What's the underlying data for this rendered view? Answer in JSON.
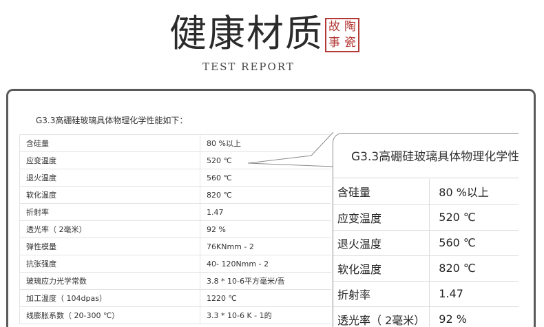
{
  "header": {
    "title": "健康材质",
    "seal": [
      "故",
      "陶",
      "事",
      "瓷"
    ],
    "subtitle": "TEST REPORT"
  },
  "spec": {
    "intro": "G3.3高硼硅玻璃具体物理化学性能如下：",
    "rows": [
      {
        "k": "含硅量",
        "v": "80 %以上"
      },
      {
        "k": "应变温度",
        "v": "520 ℃"
      },
      {
        "k": "退火温度",
        "v": "560 ℃"
      },
      {
        "k": "软化温度",
        "v": "820 ℃"
      },
      {
        "k": "折射率",
        "v": "1.47"
      },
      {
        "k": "透光率（ 2毫米）",
        "v": "92 %"
      },
      {
        "k": "弹性模量",
        "v": "76KNmm - 2"
      },
      {
        "k": "抗张强度",
        "v": "40- 120Nmm - 2"
      },
      {
        "k": "玻璃应力光学常数",
        "v": "3.8 * 10-6平方毫米/吾"
      },
      {
        "k": "加工温度（ 104dpas）",
        "v": "1220 ℃"
      },
      {
        "k": "线膨胀系数（ 20-300 ℃）",
        "v": "3.3 * 10-6 K - 1的"
      }
    ]
  },
  "zoom": {
    "title": "G3.3高硼硅玻璃具体物理化学性",
    "rows": [
      {
        "k": "含硅量",
        "v": "80 %以上"
      },
      {
        "k": "应变温度",
        "v": "520 ℃"
      },
      {
        "k": "退火温度",
        "v": "560 ℃"
      },
      {
        "k": "软化温度",
        "v": "820 ℃"
      },
      {
        "k": "折射率",
        "v": "1.47"
      },
      {
        "k": "透光率（ 2毫米）",
        "v": "92 %"
      }
    ]
  },
  "colors": {
    "seal": "#b23a36",
    "frame": "#5a5a5a"
  }
}
